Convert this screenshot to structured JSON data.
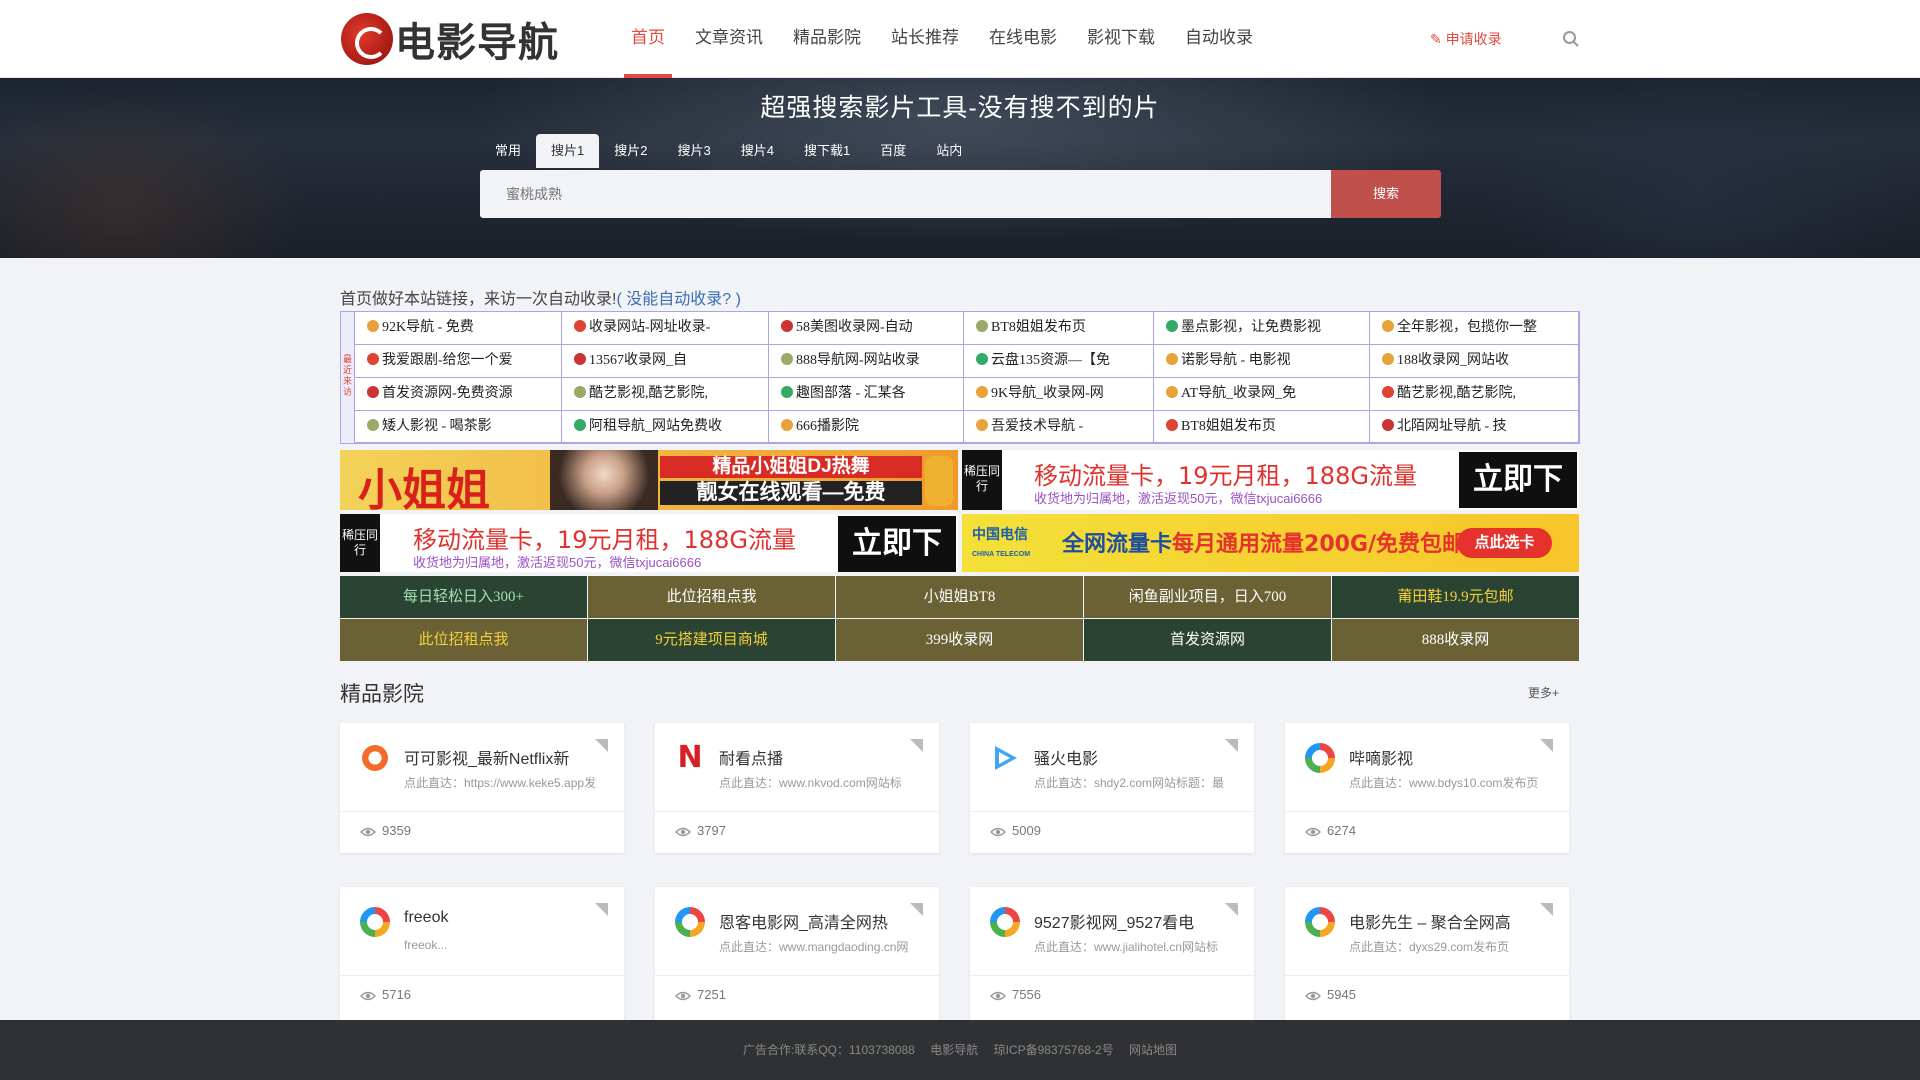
{
  "brand": {
    "logo_text": "电影导航"
  },
  "nav": [
    "首页",
    "文章资讯",
    "精品影院",
    "站长推荐",
    "在线电影",
    "影视下载",
    "自动收录"
  ],
  "header": {
    "apply": "申请收录"
  },
  "hero": {
    "title": "超强搜索影片工具-没有搜不到的片",
    "tabs": [
      "常用",
      "搜片1",
      "搜片2",
      "搜片3",
      "搜片4",
      "搜下载1",
      "百度",
      "站内"
    ],
    "placeholder": "蜜桃成熟",
    "button": "搜索"
  },
  "auto": {
    "title": "首页做好本站链接，来访一次自动收录!",
    "link": "( 没能自动收录? )",
    "side": "最近来访",
    "rows": [
      [
        "92K导航 - 免费",
        "收录网站-网址收录-",
        "58美图收录网-自动",
        "BT8姐姐发布页",
        "墨点影视，让免费影视",
        "全年影视，包揽你一整"
      ],
      [
        "我爱跟剧-给您一个爱",
        "13567收录网_自",
        "888导航网-网站收录",
        "云盘135资源—【免",
        "诺影导航 - 电影视",
        "188收录网_网站收"
      ],
      [
        "首发资源网-免费资源",
        "酷艺影视,酷艺影院,",
        "趣图部落 - 汇某各",
        "9K导航_收录网-网",
        "AT导航_收录网_免",
        "酷艺影视,酷艺影院,"
      ],
      [
        "矮人影视 - 喝茶影",
        "阿租导航_网站免费收",
        "666播影院",
        "吾爱技术导航 -",
        "BT8姐姐发布页",
        "北陌网址导航 - 技"
      ]
    ]
  },
  "ads": {
    "a1": {
      "big": "小姐姐",
      "line1": "精品小姐姐DJ热舞",
      "line2": "靓女在线观看—免费"
    },
    "m1": {
      "label": "稀压同行",
      "title": "移动流量卡，19元月租，188G流量",
      "sub": "收货地为归属地，激活返现50元，微信txjucai6666",
      "buy": "立即下单"
    },
    "m2": {
      "label": "稀压同行",
      "title": "移动流量卡，19元月租，188G流量",
      "sub": "收货地为归属地，激活返现50元，微信txjucai6666",
      "buy": "立即下单"
    },
    "t1": {
      "logo": "中国电信",
      "logo_en": "CHINA TELECOM",
      "title": "全网流量卡",
      "title2": "每月通用流量200G/免费包邮",
      "btn": "点此选卡"
    }
  },
  "textlinks": [
    [
      "每日轻松日入300+",
      "此位招租点我",
      "小姐姐BT8",
      "闲鱼副业项目，日入700",
      "莆田鞋19.9元包邮"
    ],
    [
      "此位招租点我",
      "9元搭建项目商城",
      "399收录网",
      "首发资源网",
      "888收录网"
    ]
  ],
  "section": {
    "title": "精品影院",
    "more": "更多+"
  },
  "cards": [
    {
      "name": "可可影视_最新Netflix新",
      "desc": "点此直达：https://www.keke5.app发",
      "count": "9359",
      "icon": "keke-icon"
    },
    {
      "name": "耐看点播",
      "desc": "点此直达：www.nkvod.com网站标",
      "count": "3797",
      "icon": "netflix-n-icon"
    },
    {
      "name": "骚火电影",
      "desc": "点此直达：shdy2.com网站标题：最",
      "count": "5009",
      "icon": "play-icon"
    },
    {
      "name": "哔嘀影视",
      "desc": "点此直达：www.bdys10.com发布页",
      "count": "6274",
      "icon": "ring-icon"
    },
    {
      "name": "freeok",
      "desc": "freeok...",
      "count": "5716",
      "icon": "ring-icon"
    },
    {
      "name": "恩客电影网_高清全网热",
      "desc": "点此直达：www.mangdaoding.cn网",
      "count": "7251",
      "icon": "ring-icon"
    },
    {
      "name": "9527影视网_9527看电",
      "desc": "点此直达：www.jialihotel.cn网站标",
      "count": "7556",
      "icon": "ring-icon"
    },
    {
      "name": "电影先生 – 聚合全网高",
      "desc": "点此直达：dyxs29.com发布页",
      "count": "5945",
      "icon": "ring-icon"
    }
  ],
  "footer": [
    "广告合作:联系QQ：1103738088",
    "电影导航",
    "琼ICP备98375768-2号",
    "网站地图"
  ]
}
